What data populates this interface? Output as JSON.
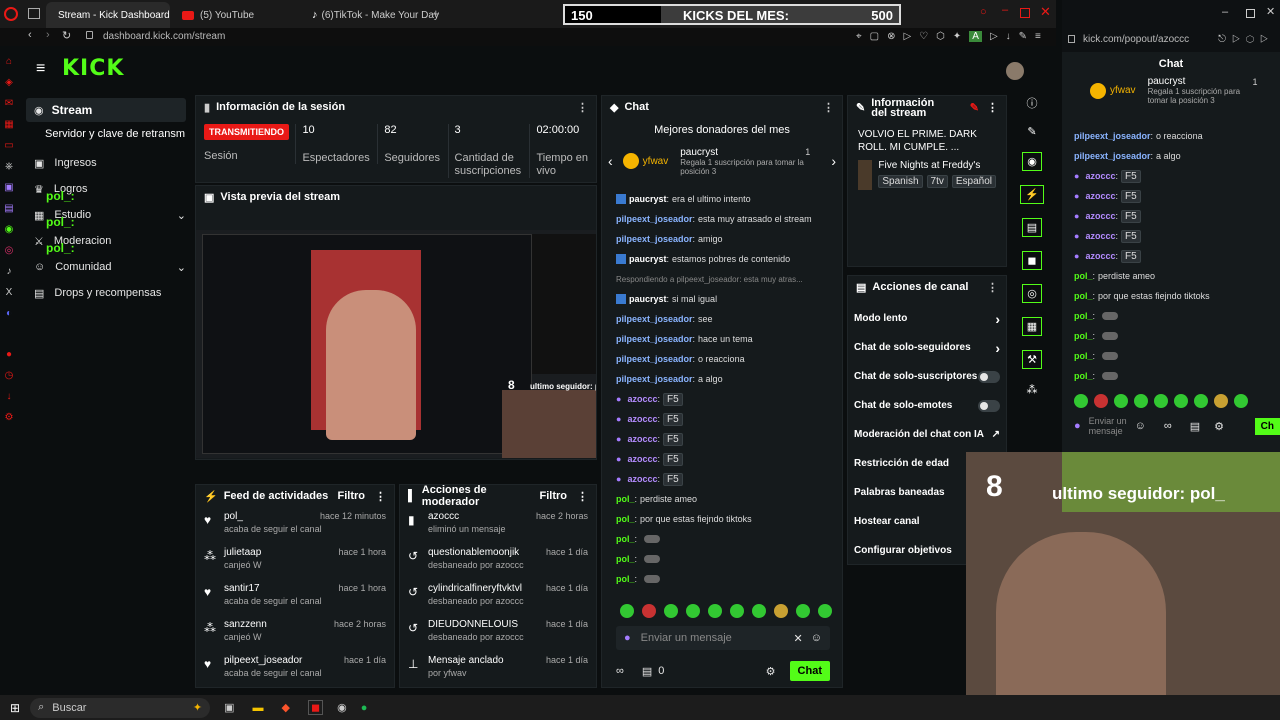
{
  "browser": {
    "tabs": [
      {
        "label": "Stream - Kick Dashboard"
      },
      {
        "label": "(5) YouTube"
      },
      {
        "label": "(6)TikTok - Make Your Day"
      }
    ],
    "url": "dashboard.kick.com/stream"
  },
  "kicks_bar": {
    "left": "150",
    "title": "KICKS DEL MES:",
    "right": "500"
  },
  "popout_browser": {
    "url": "kick.com/popout/azoccc"
  },
  "logo": "KICK",
  "sidebar": {
    "stream": "Stream",
    "server": "Servidor y clave de retransm",
    "ingresos": "Ingresos",
    "logros": "Logros",
    "estudio": "Estudio",
    "moderacion": "Moderacion",
    "comunidad": "Comunidad",
    "drops": "Drops y recompensas",
    "overlay_name": "pol_:"
  },
  "session": {
    "title": "Información de la sesión",
    "live_badge": "TRANSMITIENDO",
    "stats": [
      {
        "value": "10",
        "label": "Espectadores"
      },
      {
        "value": "82",
        "label": "Seguidores"
      },
      {
        "value": "3",
        "label": "Cantidad de suscripciones"
      },
      {
        "value": "02:00:00",
        "label": "Tiempo en vivo"
      }
    ],
    "session_label": "Sesión"
  },
  "preview": {
    "title": "Vista previa del stream",
    "follower_num": "8",
    "follower_text": "ultimo seguidor: pol_"
  },
  "activity": {
    "title": "Feed de actividades",
    "filter": "Filtro",
    "items": [
      {
        "user": "pol_",
        "time": "hace 12 minutos",
        "desc": "acaba de seguir el canal"
      },
      {
        "user": "julietaap",
        "time": "hace 1 hora",
        "desc": "canjeó W"
      },
      {
        "user": "santir17",
        "time": "hace 1 hora",
        "desc": "acaba de seguir el canal"
      },
      {
        "user": "sanzzenn",
        "time": "hace 2 horas",
        "desc": "canjeó W"
      },
      {
        "user": "pilpeext_joseador",
        "time": "hace 1 día",
        "desc": "acaba de seguir el canal"
      }
    ]
  },
  "modactions": {
    "title": "Acciones de moderador",
    "filter": "Filtro",
    "items": [
      {
        "user": "azoccc",
        "time": "hace 2 horas",
        "desc": "eliminó un mensaje"
      },
      {
        "user": "questionablemoonjik",
        "time": "hace 1 día",
        "desc": "desbaneado por azoccc"
      },
      {
        "user": "cylindricalfineryftvktvl",
        "time": "hace 1 día",
        "desc": "desbaneado por azoccc"
      },
      {
        "user": "DIEUDONNELOUIS",
        "time": "hace 1 día",
        "desc": "desbaneado por azoccc"
      },
      {
        "user": "Mensaje anclado",
        "time": "hace 1 día",
        "desc": "por yfwav"
      }
    ]
  },
  "chat": {
    "title": "Chat",
    "donors_title": "Mejores donadores del mes",
    "donor1": "yfwav",
    "donor2": "paucryst",
    "donor2_count": "1",
    "donor2_desc": "Regala 1 suscripción para tomar la posición 3",
    "messages": [
      {
        "user": "paucryst",
        "text": "era el ultimo intento"
      },
      {
        "user": "pilpeext_joseador",
        "text": "esta muy atrasado el stream"
      },
      {
        "user": "pilpeext_joseador",
        "text": "amigo"
      },
      {
        "user": "paucryst",
        "text": "estamos pobres de contenido"
      },
      {
        "user": "",
        "text": "Respondiendo a pilpeext_joseador: esta muy atras..."
      },
      {
        "user": "paucryst",
        "text": "si mal igual"
      },
      {
        "user": "pilpeext_joseador",
        "text": "see"
      },
      {
        "user": "pilpeext_joseador",
        "text": "hace un tema"
      },
      {
        "user": "pilpeext_joseador",
        "text": "o reacciona"
      },
      {
        "user": "pilpeext_joseador",
        "text": "a algo"
      },
      {
        "user": "azoccc",
        "text": "F5"
      },
      {
        "user": "azoccc",
        "text": "F5"
      },
      {
        "user": "azoccc",
        "text": "F5"
      },
      {
        "user": "azoccc",
        "text": "F5"
      },
      {
        "user": "azoccc",
        "text": "F5"
      },
      {
        "user": "pol_",
        "text": "perdiste ameo"
      },
      {
        "user": "pol_",
        "text": "por que estas fiejndo tiktoks"
      },
      {
        "user": "pol_",
        "text": ""
      },
      {
        "user": "pol_",
        "text": ""
      },
      {
        "user": "pol_",
        "text": ""
      },
      {
        "user": "pol_",
        "text": ""
      }
    ],
    "input_placeholder": "Enviar un mensaje",
    "send_label": "Chat",
    "sub_count": "0"
  },
  "info": {
    "title": "Información del stream",
    "stream_title": "VOLVIO EL PRIME. DARK ROLL. MI CUMPLE. ...",
    "game": "Five Nights at Freddy's",
    "tags": [
      "Spanish",
      "7tv",
      "Español"
    ]
  },
  "channel_actions": {
    "title": "Acciones de canal",
    "items": [
      {
        "label": "Modo lento"
      },
      {
        "label": "Chat de solo-seguidores"
      },
      {
        "label": "Chat de solo-suscriptores"
      },
      {
        "label": "Chat de solo-emotes"
      },
      {
        "label": "Moderación del chat con IA"
      },
      {
        "label": "Restricción de edad"
      },
      {
        "label": "Palabras baneadas"
      },
      {
        "label": "Hostear canal"
      },
      {
        "label": "Configurar objetivos"
      }
    ]
  },
  "overlay": {
    "number": "8",
    "text": "ultimo seguidor: pol_"
  },
  "popout_chat": {
    "title": "Chat",
    "donor1": "yfwav",
    "donor2": "paucryst",
    "donor2_count": "1",
    "donor2_desc": "Regala 1 suscripción para tomar la posición 3",
    "messages": [
      {
        "user": "pilpeext_joseador",
        "text": "o reacciona"
      },
      {
        "user": "pilpeext_joseador",
        "text": "a algo"
      },
      {
        "user": "azoccc",
        "text": "F5"
      },
      {
        "user": "azoccc",
        "text": "F5"
      },
      {
        "user": "azoccc",
        "text": "F5"
      },
      {
        "user": "azoccc",
        "text": "F5"
      },
      {
        "user": "azoccc",
        "text": "F5"
      },
      {
        "user": "pol_",
        "text": "perdiste ameo"
      },
      {
        "user": "pol_",
        "text": "por que estas fiejndo tiktoks"
      },
      {
        "user": "pol_",
        "text": ""
      },
      {
        "user": "pol_",
        "text": ""
      },
      {
        "user": "pol_",
        "text": ""
      },
      {
        "user": "pol_",
        "text": ""
      }
    ],
    "input_placeholder": "Enviar un mensaje",
    "send_label": "Ch"
  },
  "taskbar": {
    "search": "Buscar"
  },
  "colors": {
    "accent": "#53fc18",
    "live": "#e91916",
    "panel": "#151a1c"
  }
}
